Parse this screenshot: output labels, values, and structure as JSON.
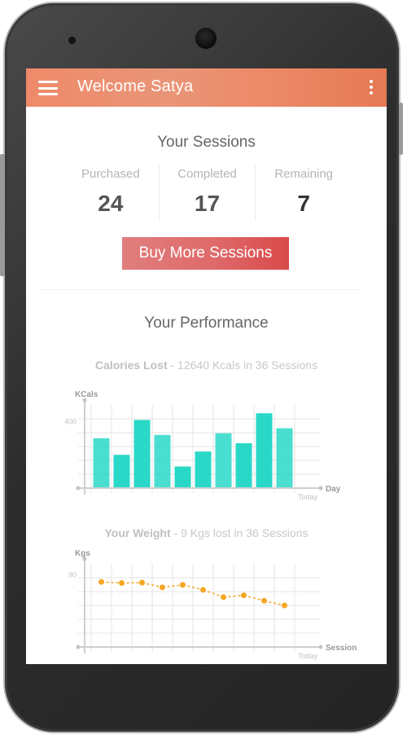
{
  "app": {
    "title": "Welcome Satya"
  },
  "sessions": {
    "title": "Your Sessions",
    "stats": [
      {
        "label": "Purchased",
        "value": "24"
      },
      {
        "label": "Completed",
        "value": "17"
      },
      {
        "label": "Remaining",
        "value": "7"
      }
    ],
    "buy_button": "Buy More Sessions"
  },
  "performance": {
    "title": "Your Performance"
  },
  "colors": {
    "accent": "#ee8a69",
    "bars": "#2ad8c8",
    "line": "#f5a623",
    "button": "#df6a6a"
  },
  "chart_data": [
    {
      "type": "bar",
      "title_bold": "Calories Lost",
      "title_rest": " - 12640 Kcals in 36 Sessions",
      "xlabel": "Day",
      "ylabel": "KCals",
      "ytick": "400",
      "x_end_label": "Today",
      "ylim": [
        0,
        500
      ],
      "values": [
        300,
        200,
        410,
        320,
        130,
        220,
        330,
        270,
        450,
        360
      ]
    },
    {
      "type": "line",
      "title_bold": "Your Weight",
      "title_rest": " - 9 Kgs lost in 36 Sessions",
      "xlabel": "Session",
      "ylabel": "Kgs",
      "ytick": "90",
      "x_end_label": "Today",
      "ylim": [
        70,
        93
      ],
      "values": [
        88,
        87.7,
        87.8,
        86.5,
        87.2,
        85.8,
        83.8,
        84.3,
        82.8,
        81.5
      ]
    }
  ]
}
